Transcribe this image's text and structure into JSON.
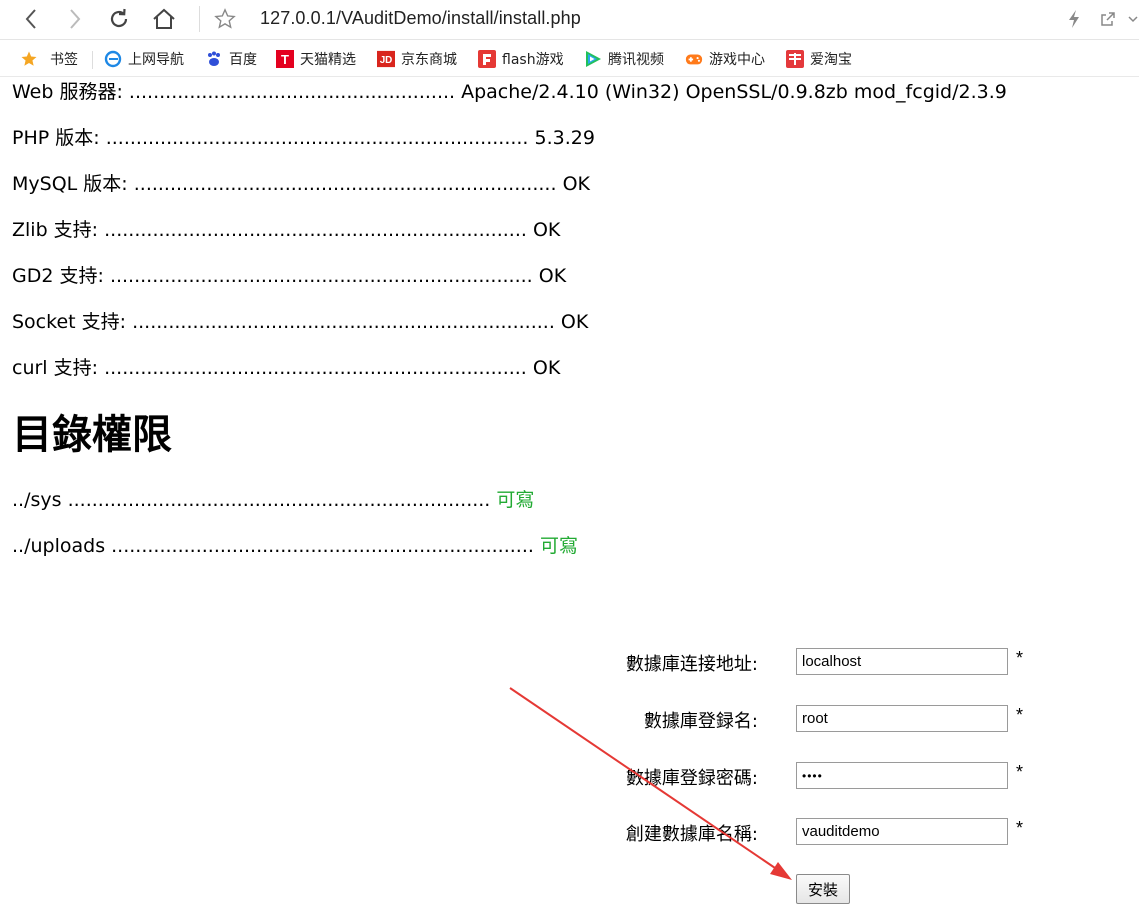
{
  "browser": {
    "url": "127.0.0.1/VAuditDemo/install/install.php",
    "bookmarks": [
      {
        "label": "书签",
        "icon": "star-icon",
        "color": "#f5a623"
      },
      {
        "label": "上网导航",
        "icon": "ie-icon",
        "color": "#1e88e5"
      },
      {
        "label": "百度",
        "icon": "baidu-paw-icon",
        "color": "#2f4fd8"
      },
      {
        "label": "天猫精选",
        "icon": "tmall-icon",
        "color": "#e4001f"
      },
      {
        "label": "京东商城",
        "icon": "jd-icon",
        "color": "#d9251d"
      },
      {
        "label": "flash游戏",
        "icon": "flash-game-icon",
        "color": "#e53935"
      },
      {
        "label": "腾讯视频",
        "icon": "tencent-video-icon",
        "color": "#22c05a"
      },
      {
        "label": "游戏中心",
        "icon": "gamepad-icon",
        "color": "#ff7a1a"
      },
      {
        "label": "爱淘宝",
        "icon": "taobao-icon",
        "color": "#e4393c"
      }
    ]
  },
  "env_checks": [
    {
      "label": "Web 服務器:",
      "dots": "......................................................",
      "value": "Apache/2.4.10 (Win32) OpenSSL/0.9.8zb mod_fcgid/2.3.9"
    },
    {
      "label": "PHP 版本:",
      "dots": "......................................................................",
      "value": "5.3.29"
    },
    {
      "label": "MySQL 版本:",
      "dots": "......................................................................",
      "value": "OK"
    },
    {
      "label": "Zlib 支持:",
      "dots": "......................................................................",
      "value": "OK"
    },
    {
      "label": "GD2 支持:",
      "dots": "......................................................................",
      "value": "OK"
    },
    {
      "label": "Socket 支持:",
      "dots": "......................................................................",
      "value": "OK"
    },
    {
      "label": "curl 支持:",
      "dots": "......................................................................",
      "value": "OK"
    }
  ],
  "section_title": "目錄權限",
  "dir_checks": [
    {
      "label": "../sys",
      "dots": "......................................................................",
      "value": "可寫"
    },
    {
      "label": "../uploads",
      "dots": "......................................................................",
      "value": "可寫"
    }
  ],
  "form": {
    "fields": [
      {
        "label": "數據庫连接地址:",
        "value": "localhost",
        "required": "*"
      },
      {
        "label": "數據庫登録名:",
        "value": "root",
        "required": "*"
      },
      {
        "label": "數據庫登録密碼:",
        "value": "••••",
        "required": "*"
      },
      {
        "label": "創建數據庫名稱:",
        "value": "vauditdemo",
        "required": "*"
      }
    ],
    "submit_label": "安裝"
  },
  "colors": {
    "writable": "#22aa33",
    "annotation_arrow": "#e53935"
  }
}
